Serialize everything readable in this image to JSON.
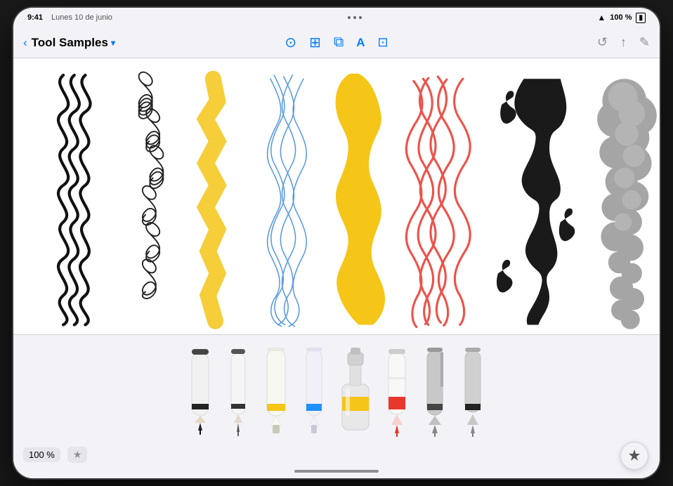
{
  "device": {
    "time": "9:41",
    "date": "Lunes 10 de junio",
    "battery": "100 %",
    "wifi": true
  },
  "header": {
    "back_label": "‹",
    "title": "Tool Samples",
    "chevron": "▾"
  },
  "toolbar_icons": {
    "pencil_circle": "✏",
    "grid": "⊞",
    "layers": "⧉",
    "text": "A",
    "image": "⊡",
    "history": "↺",
    "share": "↑",
    "edit": "✎"
  },
  "tools": [
    {
      "id": "pencil-black",
      "type": "pencil",
      "color": "#1a1a1a",
      "band_color": "#333",
      "label": "Pencil"
    },
    {
      "id": "pen-fine",
      "type": "pen",
      "color": "#e8e8e8",
      "band_color": "#444",
      "label": "Fine Pen"
    },
    {
      "id": "marker-yellow",
      "type": "marker",
      "color": "#f2f2f0",
      "band_color": "#f5c518",
      "label": "Yellow Marker"
    },
    {
      "id": "marker-blue",
      "type": "marker",
      "color": "#f0f0f5",
      "band_color": "#1e90ff",
      "label": "Blue Marker"
    },
    {
      "id": "paint-bottle",
      "type": "paint",
      "color": "#e8e8e8",
      "band_color": "#f5c518",
      "label": "Paint"
    },
    {
      "id": "crayon-red",
      "type": "crayon",
      "color": "#f5f5f5",
      "band_color": "#e8372c",
      "label": "Red Crayon"
    },
    {
      "id": "calligraphy-pen",
      "type": "calligraphypen",
      "color": "#d0d0d0",
      "band_color": "#555",
      "label": "Calligraphy"
    },
    {
      "id": "brush-gray",
      "type": "brush",
      "color": "#c0c0c0",
      "band_color": "#222",
      "label": "Gray Brush"
    }
  ],
  "zoom": "100 %",
  "bottom_bar": {
    "zoom_label": "100 %",
    "favorites_icon": "★"
  }
}
